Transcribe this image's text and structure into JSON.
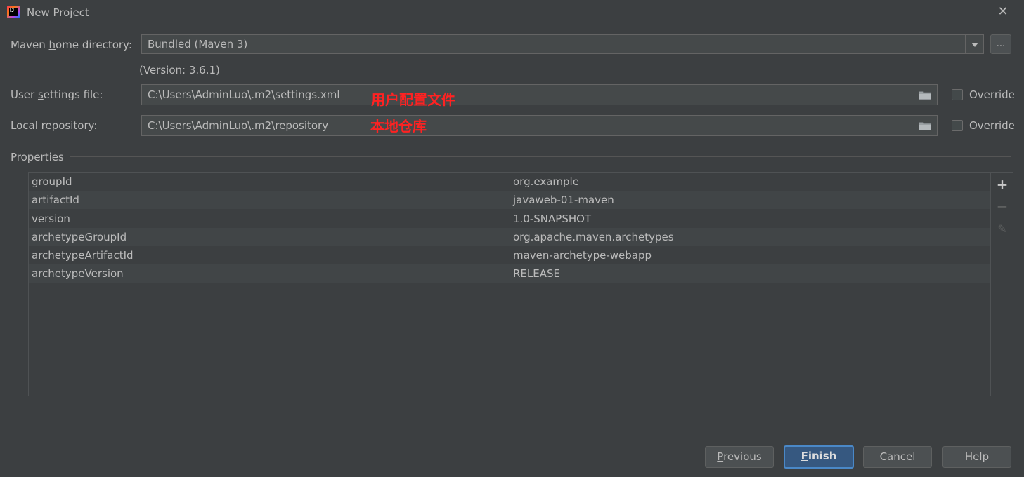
{
  "window": {
    "title": "New Project"
  },
  "maven_home": {
    "label_pre": "Maven ",
    "label_mnemonic": "h",
    "label_post": "ome directory:",
    "value": "Bundled (Maven 3)",
    "browse_label": "...",
    "version": "(Version: 3.6.1)"
  },
  "user_settings": {
    "label_pre": "User ",
    "label_mnemonic": "s",
    "label_post": "ettings file:",
    "value": "C:\\Users\\AdminLuo\\.m2\\settings.xml",
    "annotation": "用户配置文件",
    "override_label": "Override",
    "override_checked": false
  },
  "local_repo": {
    "label_pre": "Local ",
    "label_mnemonic": "r",
    "label_post": "epository:",
    "value": "C:\\Users\\AdminLuo\\.m2\\repository",
    "annotation": "本地仓库",
    "override_label": "Override",
    "override_checked": false
  },
  "properties": {
    "title": "Properties",
    "rows": [
      {
        "key": "groupId",
        "value": "org.example"
      },
      {
        "key": "artifactId",
        "value": "javaweb-01-maven"
      },
      {
        "key": "version",
        "value": "1.0-SNAPSHOT"
      },
      {
        "key": "archetypeGroupId",
        "value": "org.apache.maven.archetypes"
      },
      {
        "key": "archetypeArtifactId",
        "value": "maven-archetype-webapp"
      },
      {
        "key": "archetypeVersion",
        "value": "RELEASE"
      }
    ],
    "toolbar": {
      "add_icon": "plus-icon",
      "remove_icon": "minus-icon",
      "edit_icon": "pencil-icon"
    }
  },
  "buttons": {
    "previous_mnemonic": "P",
    "previous_rest": "revious",
    "finish_mnemonic": "F",
    "finish_rest": "inish",
    "cancel": "Cancel",
    "help": "Help"
  },
  "colors": {
    "background": "#3c3f41",
    "field": "#45494a",
    "primary_button": "#365880",
    "annotation": "#ff2222"
  }
}
